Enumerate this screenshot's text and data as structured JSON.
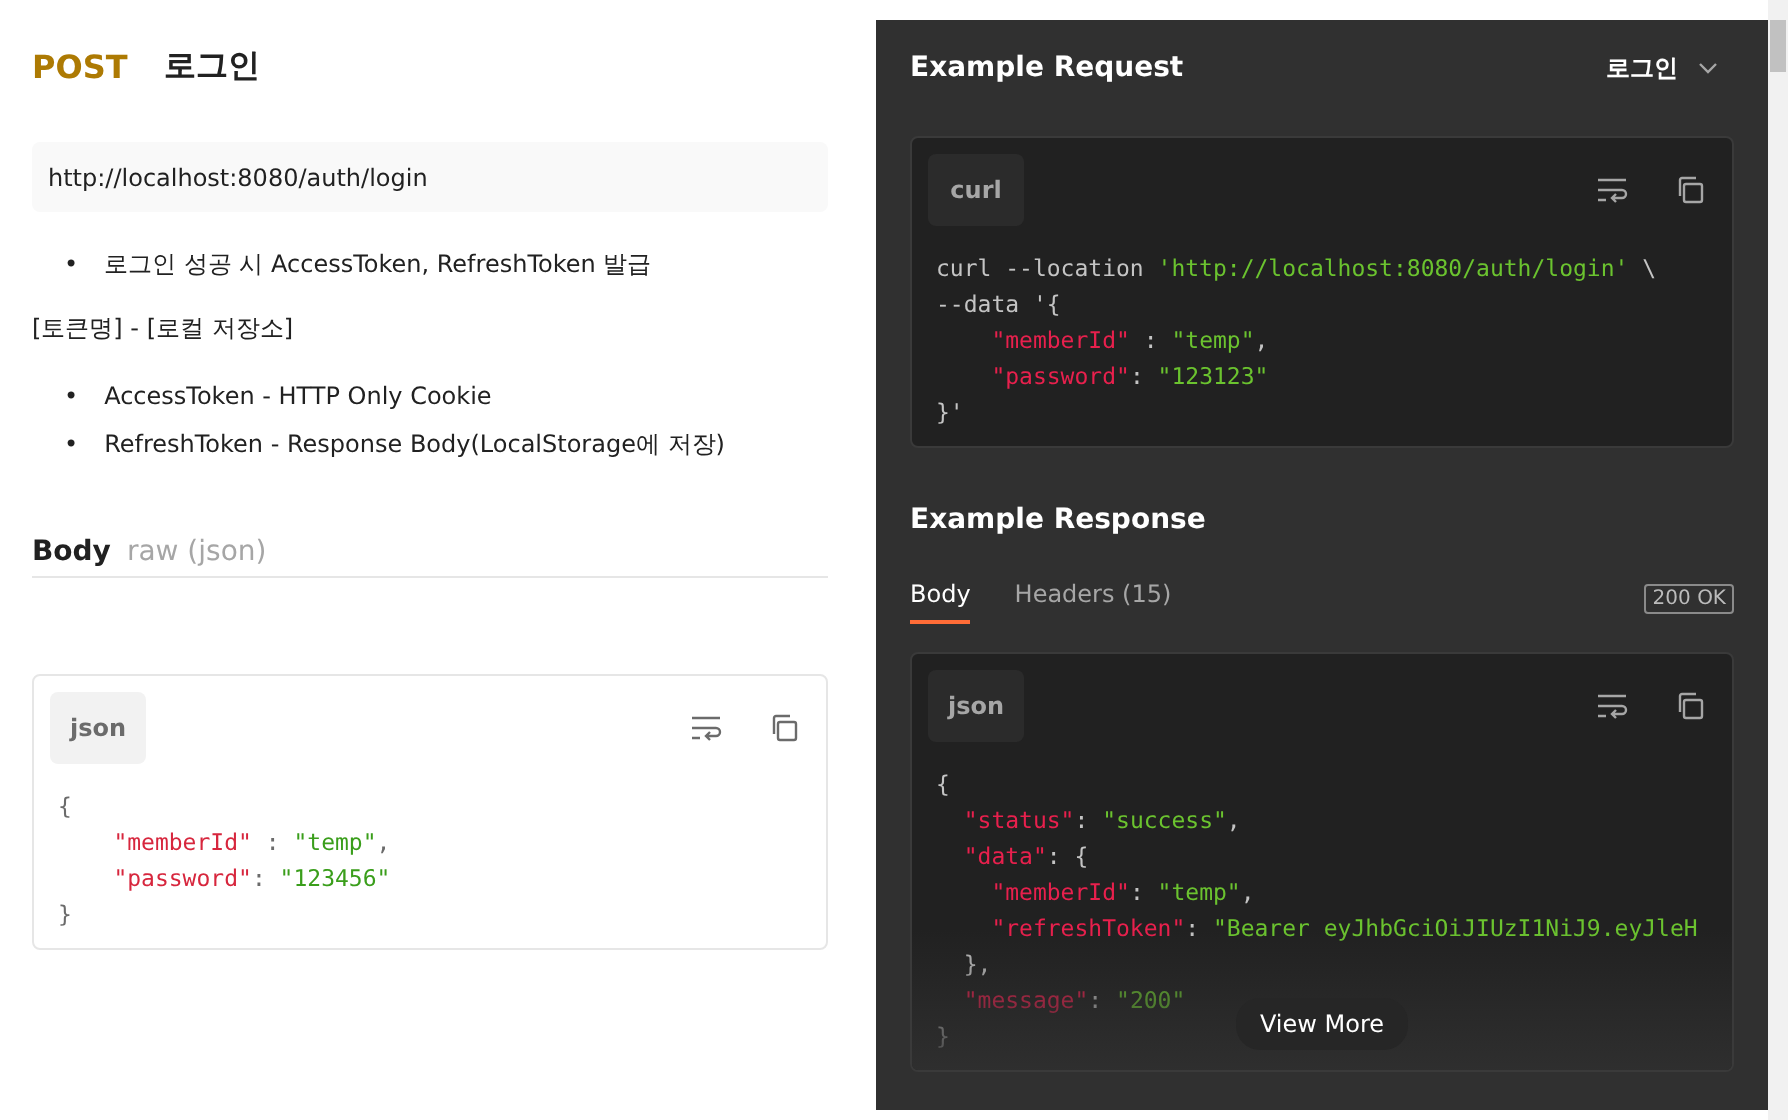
{
  "request": {
    "method": "POST",
    "title": "로그인",
    "url": "http://localhost:8080/auth/login",
    "description": [
      {
        "kind": "bullets",
        "items": [
          {
            "marker": "•",
            "text": "로그인 성공 시 AccessToken, RefreshToken 발급"
          }
        ]
      },
      {
        "kind": "paragraph",
        "text": "[토큰명] - [로컬 저장소]"
      },
      {
        "kind": "bullets",
        "items": [
          {
            "marker": "•",
            "text": "AccessToken - HTTP Only Cookie"
          },
          {
            "marker": "•",
            "text": "RefreshToken - Response Body(LocalStorage에 저장)"
          }
        ]
      }
    ],
    "body": {
      "label": "Body",
      "type": "raw (json)",
      "language": "json",
      "lines": [
        {
          "tokens": [
            {
              "kind": "punct",
              "text": "{"
            }
          ]
        },
        {
          "tokens": [
            {
              "kind": "key",
              "text": "    \"memberId\""
            },
            {
              "kind": "punct",
              "text": " : "
            },
            {
              "kind": "string",
              "text": "\"temp\""
            },
            {
              "kind": "punct",
              "text": ","
            }
          ]
        },
        {
          "tokens": [
            {
              "kind": "key",
              "text": "    \"password\""
            },
            {
              "kind": "punct",
              "text": ": "
            },
            {
              "kind": "string",
              "text": "\"123456\""
            }
          ]
        },
        {
          "tokens": [
            {
              "kind": "punct",
              "text": "}"
            }
          ]
        }
      ]
    }
  },
  "example_request": {
    "title": "Example Request",
    "selector": "로그인",
    "language": "curl",
    "lines": [
      {
        "tokens": [
          {
            "kind": "plain",
            "text": "curl --location "
          },
          {
            "kind": "string",
            "text": "'http://localhost:8080/auth/login'"
          },
          {
            "kind": "plain",
            "text": " \\"
          }
        ]
      },
      {
        "tokens": [
          {
            "kind": "plain",
            "text": "--data '{"
          }
        ]
      },
      {
        "tokens": [
          {
            "kind": "key",
            "text": "    \"memberId\""
          },
          {
            "kind": "plain",
            "text": " : "
          },
          {
            "kind": "string",
            "text": "\"temp\""
          },
          {
            "kind": "plain",
            "text": ","
          }
        ]
      },
      {
        "tokens": [
          {
            "kind": "key",
            "text": "    \"password\""
          },
          {
            "kind": "plain",
            "text": ": "
          },
          {
            "kind": "string",
            "text": "\"123123\""
          }
        ]
      },
      {
        "tokens": [
          {
            "kind": "plain",
            "text": "}'"
          }
        ]
      }
    ]
  },
  "example_response": {
    "title": "Example Response",
    "tabs": [
      {
        "label": "Body",
        "selected": true
      },
      {
        "label": "Headers (15)",
        "selected": false
      }
    ],
    "status": "200 OK",
    "language": "json",
    "view_more": "View More",
    "lines": [
      {
        "tokens": [
          {
            "kind": "plain",
            "text": "{"
          }
        ]
      },
      {
        "tokens": [
          {
            "kind": "key",
            "text": "  \"status\""
          },
          {
            "kind": "plain",
            "text": ": "
          },
          {
            "kind": "string",
            "text": "\"success\""
          },
          {
            "kind": "plain",
            "text": ","
          }
        ]
      },
      {
        "tokens": [
          {
            "kind": "key",
            "text": "  \"data\""
          },
          {
            "kind": "plain",
            "text": ": {"
          }
        ]
      },
      {
        "tokens": [
          {
            "kind": "key",
            "text": "    \"memberId\""
          },
          {
            "kind": "plain",
            "text": ": "
          },
          {
            "kind": "string",
            "text": "\"temp\""
          },
          {
            "kind": "plain",
            "text": ","
          }
        ]
      },
      {
        "tokens": [
          {
            "kind": "key",
            "text": "    \"refreshToken\""
          },
          {
            "kind": "plain",
            "text": ": "
          },
          {
            "kind": "string",
            "text": "\"Bearer eyJhbGciOiJIUzI1NiJ9.eyJleH"
          }
        ]
      },
      {
        "tokens": [
          {
            "kind": "plain",
            "text": "  },"
          }
        ]
      },
      {
        "tokens": [
          {
            "kind": "key",
            "text": "  \"message\""
          },
          {
            "kind": "plain",
            "text": ": "
          },
          {
            "kind": "string",
            "text": "\"200\""
          }
        ]
      },
      {
        "tokens": [
          {
            "kind": "plain",
            "text": "}"
          }
        ]
      }
    ]
  }
}
